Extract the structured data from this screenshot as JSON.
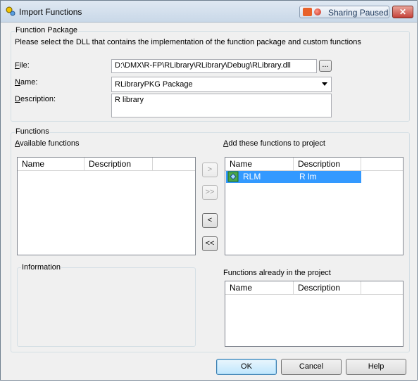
{
  "window": {
    "title": "Import Functions",
    "sharing_label": "Sharing Paused",
    "close_glyph": "✕"
  },
  "package": {
    "group_label": "Function Package",
    "instruction": "Please select the DLL that contains the implementation of the function package and custom functions",
    "file_label": "File:",
    "file_value": "D:\\DMX\\R-FP\\RLibrary\\RLibrary\\Debug\\RLibrary.dll",
    "browse_label": "...",
    "name_label": "Name:",
    "name_value": "RLibraryPKG Package",
    "description_label": "Description:",
    "description_value": "R library"
  },
  "functions": {
    "group_label": "Functions",
    "available_label": "Available functions",
    "add_label": "Add these functions to project",
    "columns": [
      "Name",
      "Description"
    ],
    "added_rows": [
      {
        "name": "RLM",
        "description": "R lm"
      }
    ],
    "info_label": "Information",
    "existing_label": "Functions already in the project",
    "move_right": ">",
    "move_all_right": ">>",
    "move_left": "<",
    "move_all_left": "<<"
  },
  "footer": {
    "ok": "OK",
    "cancel": "Cancel",
    "help": "Help"
  }
}
